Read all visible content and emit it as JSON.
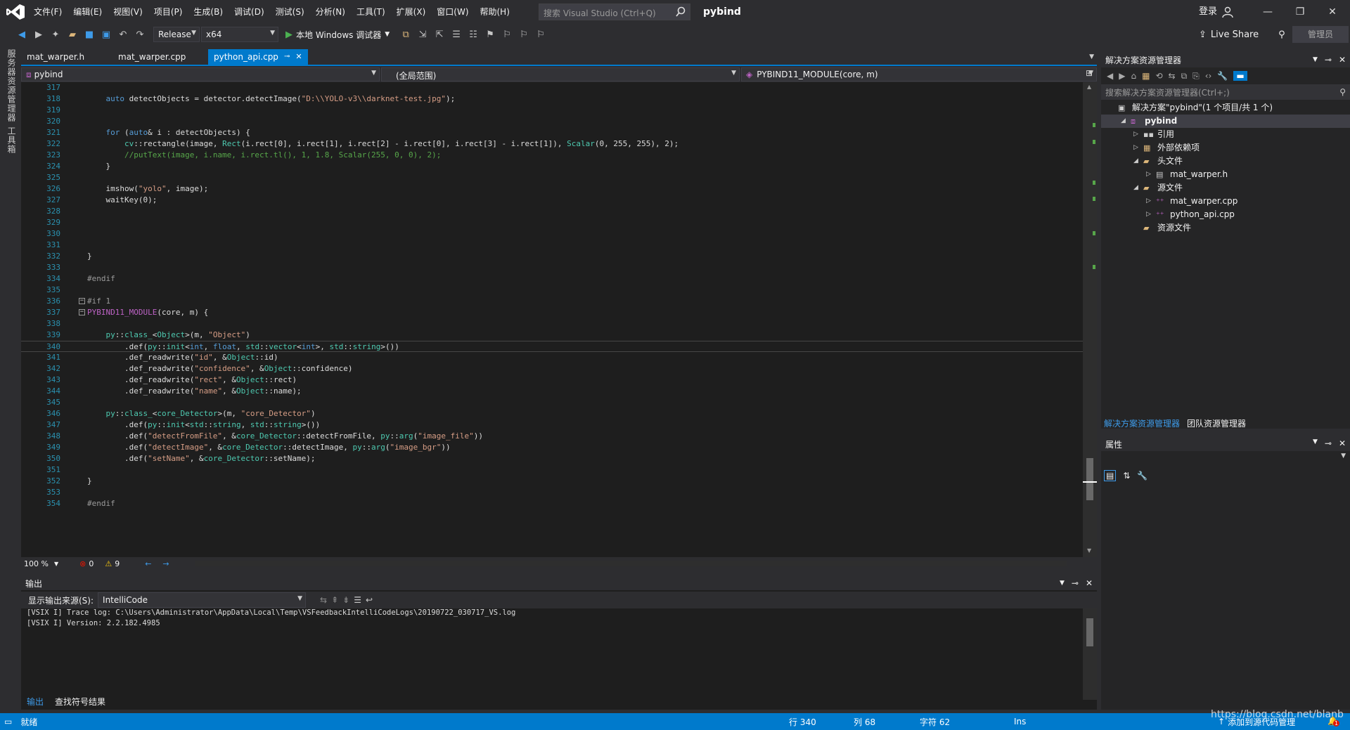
{
  "titlebar": {
    "menus": [
      "文件(F)",
      "编辑(E)",
      "视图(V)",
      "项目(P)",
      "生成(B)",
      "调试(D)",
      "测试(S)",
      "分析(N)",
      "工具(T)",
      "扩展(X)",
      "窗口(W)",
      "帮助(H)"
    ],
    "search_placeholder": "搜索 Visual Studio (Ctrl+Q)",
    "solution_name": "pybind",
    "login": "登录"
  },
  "toolbar": {
    "config": "Release",
    "platform": "x64",
    "run_label": "本地 Windows 调试器",
    "live_share": "Live Share",
    "manage": "管理员"
  },
  "leftrail": {
    "items": [
      "服务器资源管理器",
      "工具箱"
    ]
  },
  "tabs": [
    {
      "label": "mat_warper.h",
      "active": false
    },
    {
      "label": "mat_warper.cpp",
      "active": false
    },
    {
      "label": "python_api.cpp",
      "active": true
    }
  ],
  "navbar": {
    "project": "pybind",
    "scope": "(全局范围)",
    "member": "PYBIND11_MODULE(core, m)"
  },
  "editor": {
    "zoom": "100 %",
    "errors": "0",
    "warnings": "9",
    "lines": [
      {
        "n": "317",
        "html": ""
      },
      {
        "n": "318",
        "html": "    <span class='kw'>auto</span> detectObjects = detector.detectImage(<span class='st'>\"D:\\\\YOLO-v3\\\\darknet-test.jpg\"</span>);"
      },
      {
        "n": "319",
        "html": ""
      },
      {
        "n": "320",
        "html": ""
      },
      {
        "n": "321",
        "html": "    <span class='kw'>for</span> (<span class='kw'>auto</span>&amp; i : detectObjects) {"
      },
      {
        "n": "322",
        "html": "        <span class='ty'>cv</span>::rectangle(image, <span class='ty'>Rect</span>(i.rect[0], i.rect[1], i.rect[2] - i.rect[0], i.rect[3] - i.rect[1]), <span class='ty'>Scalar</span>(0, 255, 255), 2);"
      },
      {
        "n": "323",
        "html": "        <span class='cm'>//putText(image, i.name, i.rect.tl(), 1, 1.8, Scalar(255, 0, 0), 2);</span>"
      },
      {
        "n": "324",
        "html": "    }"
      },
      {
        "n": "325",
        "html": ""
      },
      {
        "n": "326",
        "html": "    imshow(<span class='st'>\"yolo\"</span>, image);"
      },
      {
        "n": "327",
        "html": "    waitKey(0);"
      },
      {
        "n": "328",
        "html": ""
      },
      {
        "n": "329",
        "html": ""
      },
      {
        "n": "330",
        "html": ""
      },
      {
        "n": "331",
        "html": ""
      },
      {
        "n": "332",
        "html": "}"
      },
      {
        "n": "333",
        "html": ""
      },
      {
        "n": "334",
        "html": "<span class='pp'>#endif</span>"
      },
      {
        "n": "335",
        "html": ""
      },
      {
        "n": "336",
        "html": "<span class='pp'>#if 1</span>",
        "fold": true
      },
      {
        "n": "337",
        "html": "<span class='mc'>PYBIND11_MODULE</span>(core, m) {",
        "fold": true
      },
      {
        "n": "338",
        "html": ""
      },
      {
        "n": "339",
        "html": "    <span class='ty'>py</span>::<span class='ty'>class_</span>&lt;<span class='ty'>Object</span>&gt;(m, <span class='st'>\"Object\"</span>)"
      },
      {
        "n": "340",
        "html": "        .def(<span class='ty'>py</span>::<span class='ty'>init</span>&lt;<span class='kw'>int</span>, <span class='kw'>float</span>, <span class='ty'>std</span>::<span class='ty'>vector</span>&lt;<span class='kw'>int</span>&gt;, <span class='ty'>std</span>::<span class='ty'>string</span>&gt;())",
        "current": true
      },
      {
        "n": "341",
        "html": "        .def_readwrite(<span class='st'>\"id\"</span>, &amp;<span class='ty'>Object</span>::id)"
      },
      {
        "n": "342",
        "html": "        .def_readwrite(<span class='st'>\"confidence\"</span>, &amp;<span class='ty'>Object</span>::confidence)"
      },
      {
        "n": "343",
        "html": "        .def_readwrite(<span class='st'>\"rect\"</span>, &amp;<span class='ty'>Object</span>::rect)"
      },
      {
        "n": "344",
        "html": "        .def_readwrite(<span class='st'>\"name\"</span>, &amp;<span class='ty'>Object</span>::name);"
      },
      {
        "n": "345",
        "html": ""
      },
      {
        "n": "346",
        "html": "    <span class='ty'>py</span>::<span class='ty'>class_</span>&lt;<span class='ty'>core_Detector</span>&gt;(m, <span class='st'>\"core_Detector\"</span>)"
      },
      {
        "n": "347",
        "html": "        .def(<span class='ty'>py</span>::<span class='ty'>init</span>&lt;<span class='ty'>std</span>::<span class='ty'>string</span>, <span class='ty'>std</span>::<span class='ty'>string</span>&gt;())"
      },
      {
        "n": "348",
        "html": "        .def(<span class='st'>\"detectFromFile\"</span>, &amp;<span class='ty'>core_Detector</span>::detectFromFile, <span class='ty'>py</span>::<span class='ty'>arg</span>(<span class='st'>\"image_file\"</span>))"
      },
      {
        "n": "349",
        "html": "        .def(<span class='st'>\"detectImage\"</span>, &amp;<span class='ty'>core_Detector</span>::detectImage, <span class='ty'>py</span>::<span class='ty'>arg</span>(<span class='st'>\"image_bgr\"</span>))"
      },
      {
        "n": "350",
        "html": "        .def(<span class='st'>\"setName\"</span>, &amp;<span class='ty'>core_Detector</span>::setName);"
      },
      {
        "n": "351",
        "html": ""
      },
      {
        "n": "352",
        "html": "}"
      },
      {
        "n": "353",
        "html": ""
      },
      {
        "n": "354",
        "html": "<span class='pp'>#endif</span>"
      }
    ]
  },
  "output": {
    "title": "输出",
    "source_label": "显示输出来源(S):",
    "source_value": "IntelliCode",
    "lines": [
      "[VSIX I] Trace log: C:\\Users\\Administrator\\AppData\\Local\\Temp\\VSFeedbackIntelliCodeLogs\\20190722_030717_VS.log",
      "[VSIX I] Version: 2.2.182.4985"
    ],
    "tabs": [
      "输出",
      "查找符号结果"
    ]
  },
  "solution_explorer": {
    "title": "解决方案资源管理器",
    "search_placeholder": "搜索解决方案资源管理器(Ctrl+;)",
    "tree": [
      {
        "label": "解决方案\"pybind\"(1 个项目/共 1 个)",
        "indent": 0,
        "arrow": "",
        "icon": "solution-icon",
        "bold": false
      },
      {
        "label": "pybind",
        "indent": 1,
        "arrow": "◢",
        "icon": "project-icon",
        "bold": true,
        "selected": true
      },
      {
        "label": "引用",
        "indent": 2,
        "arrow": "▷",
        "icon": "references-icon",
        "bold": false
      },
      {
        "label": "外部依赖项",
        "indent": 2,
        "arrow": "▷",
        "icon": "external-deps-icon",
        "bold": false
      },
      {
        "label": "头文件",
        "indent": 2,
        "arrow": "◢",
        "icon": "folder-icon",
        "bold": false
      },
      {
        "label": "mat_warper.h",
        "indent": 3,
        "arrow": "▷",
        "icon": "header-file-icon",
        "bold": false
      },
      {
        "label": "源文件",
        "indent": 2,
        "arrow": "◢",
        "icon": "folder-icon",
        "bold": false
      },
      {
        "label": "mat_warper.cpp",
        "indent": 3,
        "arrow": "▷",
        "icon": "cpp-file-icon",
        "bold": false
      },
      {
        "label": "python_api.cpp",
        "indent": 3,
        "arrow": "▷",
        "icon": "cpp-file-icon",
        "bold": false
      },
      {
        "label": "资源文件",
        "indent": 2,
        "arrow": "",
        "icon": "folder-icon",
        "bold": false
      }
    ],
    "bottom_tabs": [
      "解决方案资源管理器",
      "团队资源管理器"
    ]
  },
  "properties": {
    "title": "属性"
  },
  "statusbar": {
    "ready": "就绪",
    "line": "行 340",
    "col": "列 68",
    "char": "字符 62",
    "mode": "Ins",
    "source_control": "添加到源代码管理",
    "watermark": "https://blog.csdn.net/blanb",
    "notifications": "1"
  },
  "colors": {
    "accent": "#007acc",
    "background": "#2d2d30",
    "editor": "#1e1e1e"
  }
}
